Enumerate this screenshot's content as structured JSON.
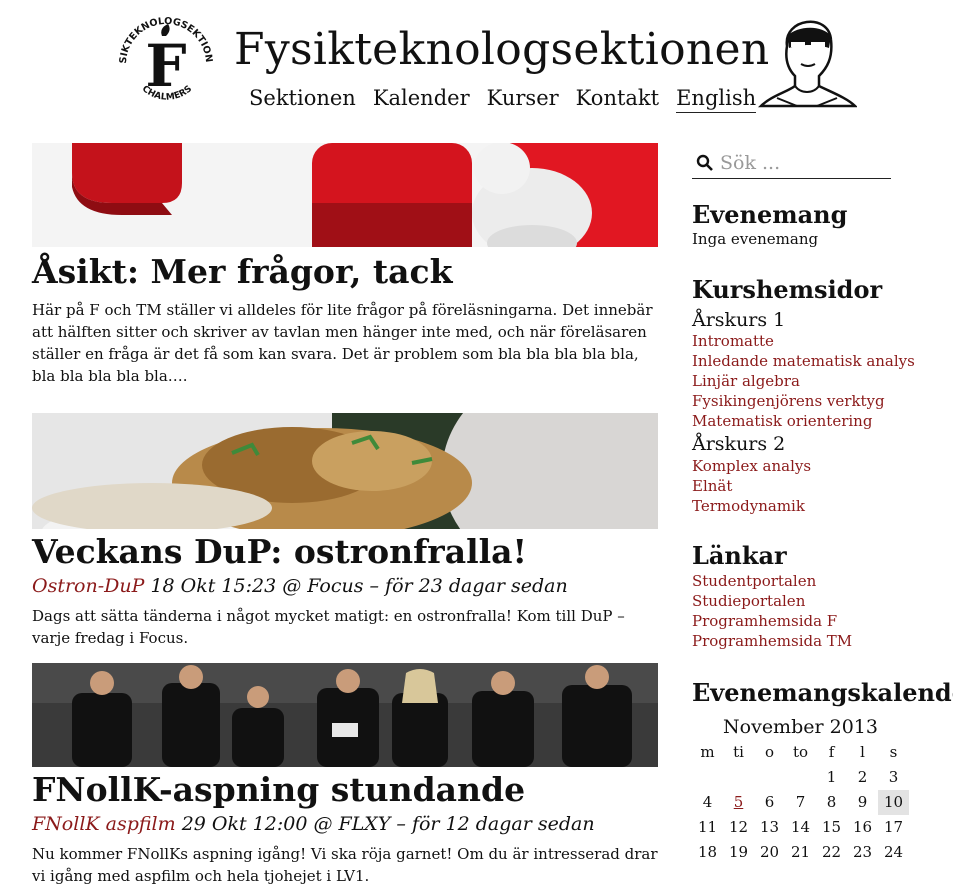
{
  "header": {
    "logo_text": "FYSIKTEKNOLOGSEKTIONEN",
    "logo_bottom": "CHALMERS",
    "logo_letter": "F",
    "title": "Fysikteknologsektionen",
    "nav": [
      "Sektionen",
      "Kalender",
      "Kurser",
      "Kontakt",
      "English"
    ]
  },
  "posts": [
    {
      "title": "Åsikt: Mer frågor, tack",
      "text": "Här på F och TM ställer vi alldeles för lite frågor på föreläsningarna. Det innebär att hälften sitter och skriver av tavlan men hänger inte med, och när föreläsaren ställer en fråga är det få som kan svara. Det är problem som bla bla bla bla bla, bla bla bla bla bla…."
    },
    {
      "title": "Veckans DuP: ostronfralla!",
      "author": "Ostron-DuP",
      "meta": " 18 Okt 15:23 @ Focus – för 23 dagar sedan",
      "text": "Dags att sätta tänderna i något mycket matigt: en ostronfralla! Kom till DuP – varje fredag i Focus."
    },
    {
      "title": "FNollK-aspning stundande",
      "author": "FNollK aspfilm",
      "meta": " 29 Okt 12:00 @ FLXY – för 12 dagar sedan",
      "text": "Nu kommer FNollKs aspning igång! Vi ska röja garnet! Om du är intresserad drar vi igång med aspfilm och hela tjohejet i LV1."
    }
  ],
  "sidebar": {
    "search_placeholder": "Sök ...",
    "events_heading": "Evenemang",
    "events_empty": "Inga evenemang",
    "courses_heading": "Kurshemsidor",
    "year1": "Årskurs 1",
    "year1_links": [
      "Intromatte",
      "Inledande matematisk analys",
      "Linjär algebra",
      "Fysikingenjörens verktyg",
      "Matematisk orientering"
    ],
    "year2": "Årskurs 2",
    "year2_links": [
      "Komplex analys",
      "Elnät",
      "Termodynamik"
    ],
    "links_heading": "Länkar",
    "links": [
      "Studentportalen",
      "Studieportalen",
      "Programhemsida F",
      "Programhemsida TM"
    ],
    "calendar_heading": "Evenemangskalender",
    "calendar": {
      "month": "November 2013",
      "weekdays": [
        "m",
        "ti",
        "o",
        "to",
        "f",
        "l",
        "s"
      ],
      "weeks": [
        [
          "",
          "",
          "",
          "",
          "1",
          "2",
          "3"
        ],
        [
          "4",
          "5",
          "6",
          "7",
          "8",
          "9",
          "10"
        ],
        [
          "11",
          "12",
          "13",
          "14",
          "15",
          "16",
          "17"
        ],
        [
          "18",
          "19",
          "20",
          "21",
          "22",
          "23",
          "24"
        ]
      ],
      "linked_day": "5",
      "today": "10"
    }
  },
  "colors": {
    "link": "#8b1a1a",
    "text": "#111111"
  }
}
